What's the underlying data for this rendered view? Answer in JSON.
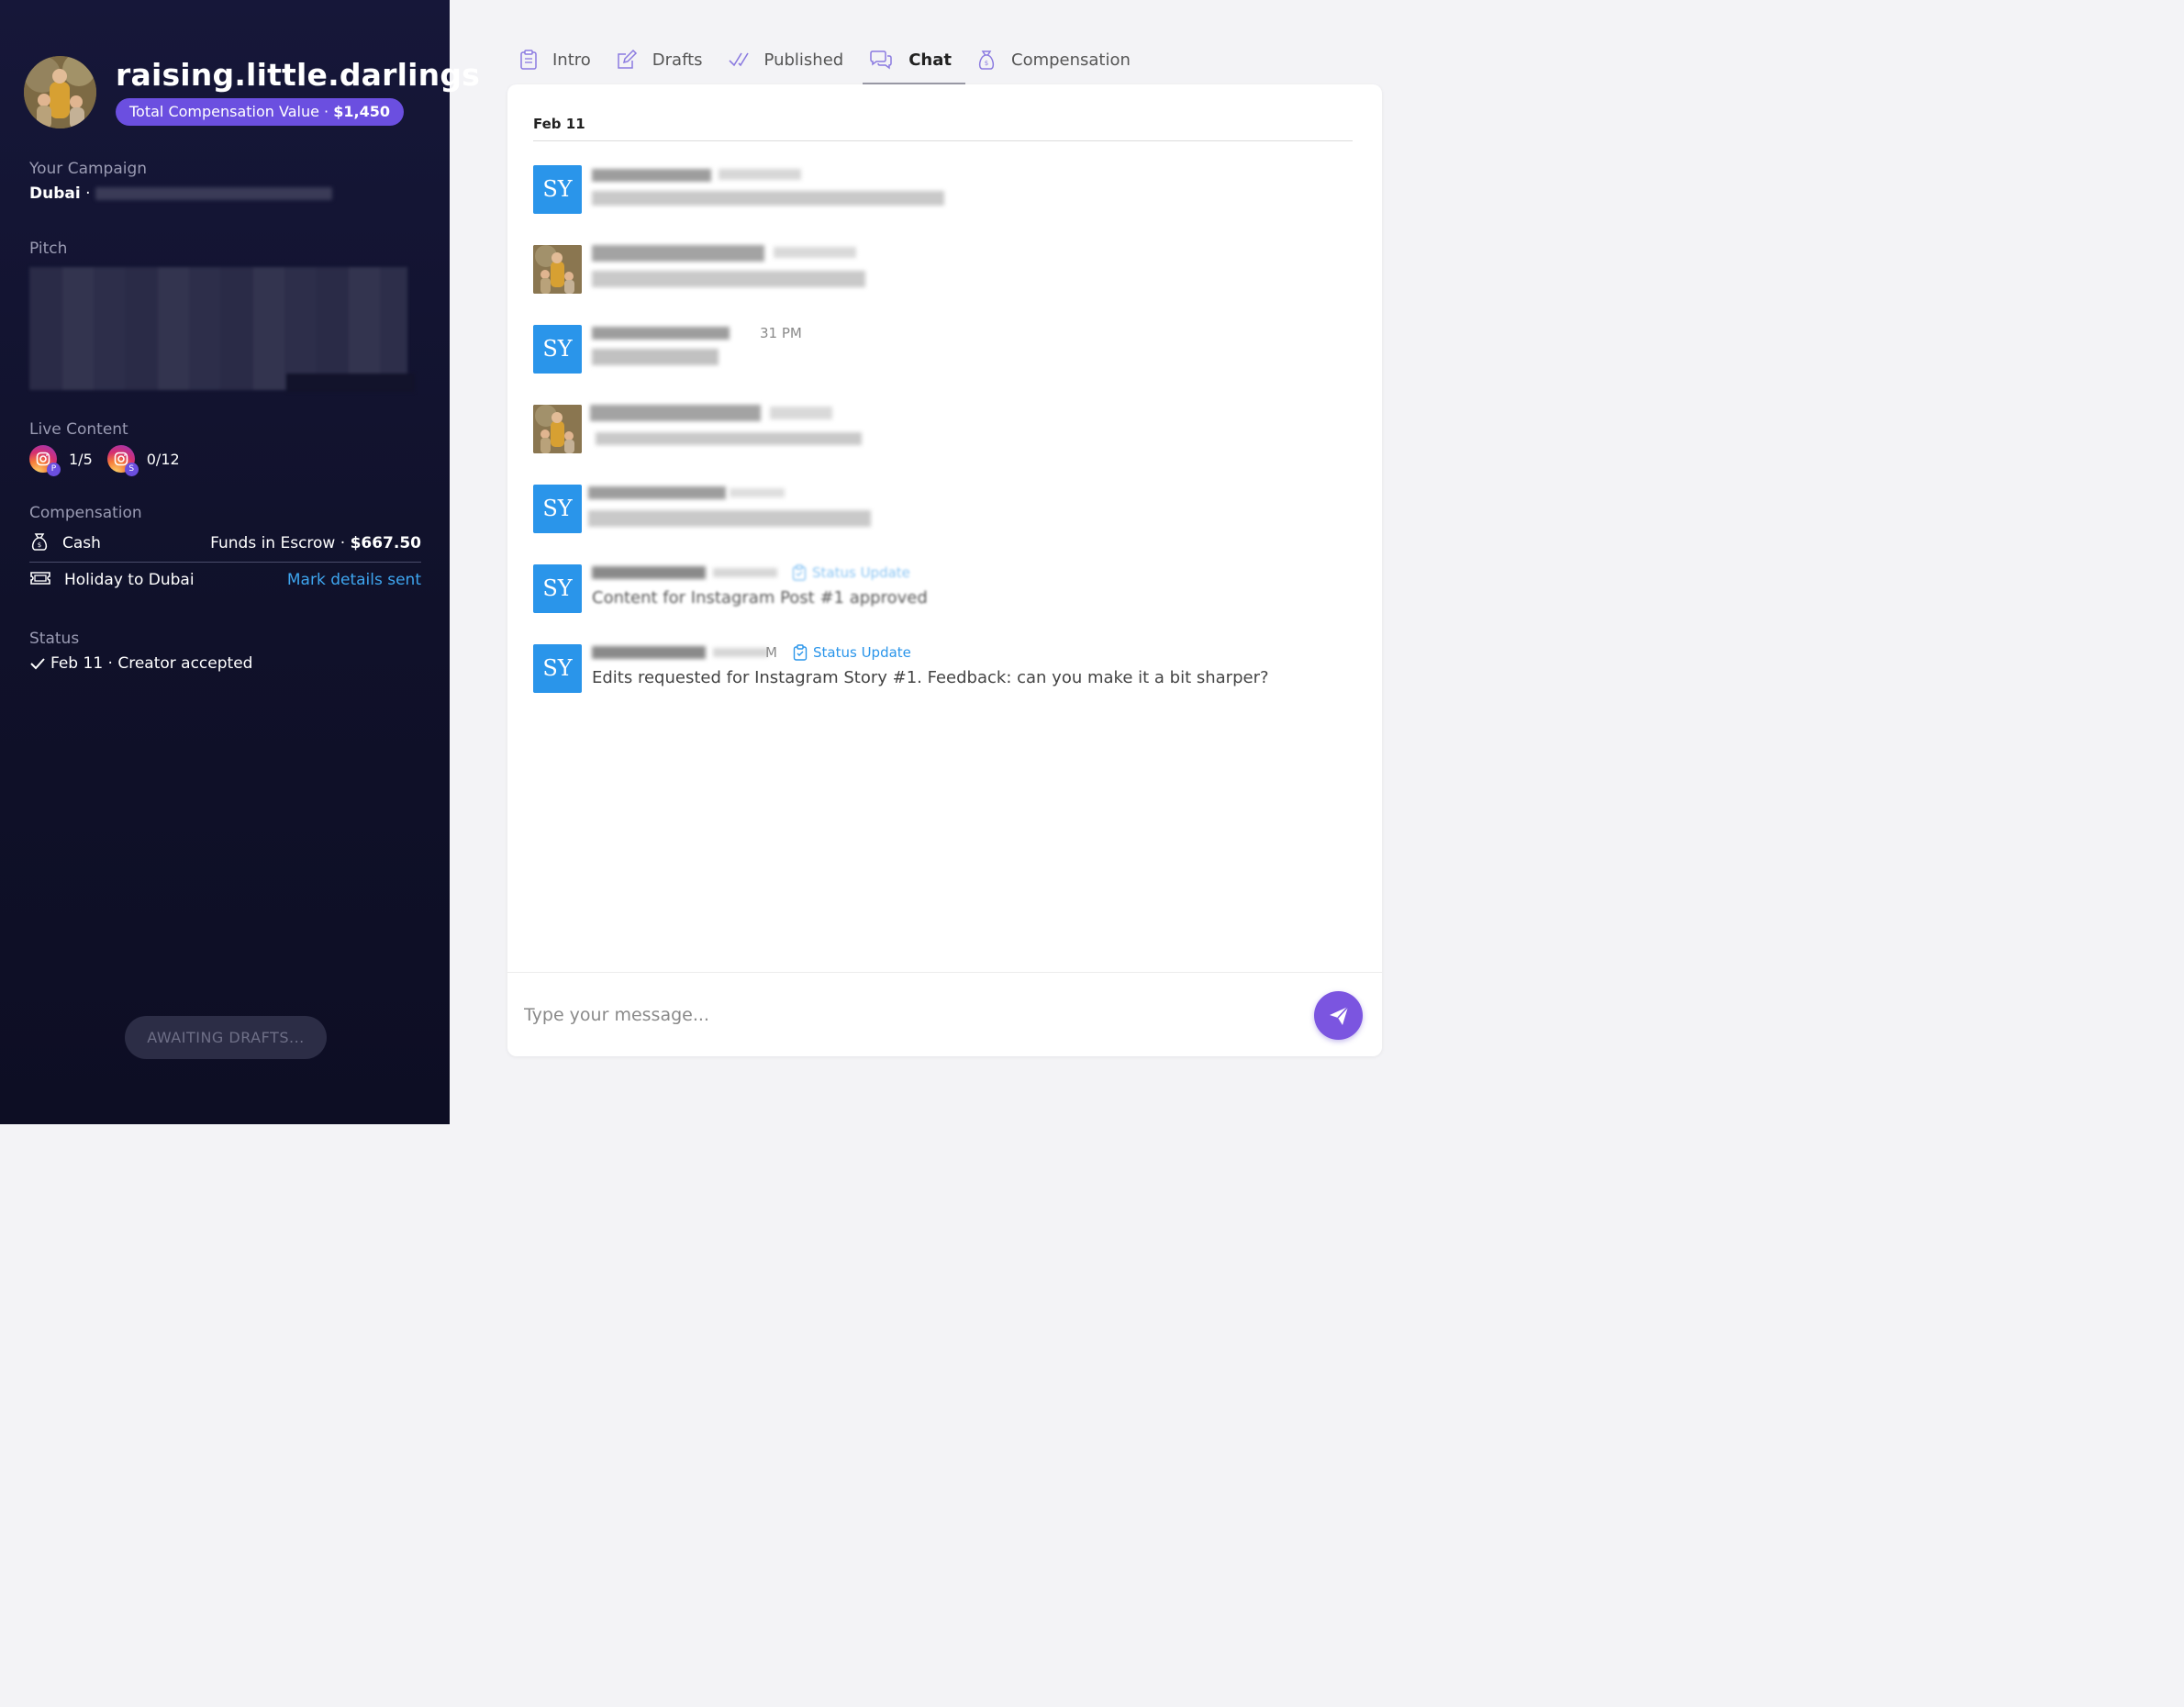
{
  "profile": {
    "handle": "raising.little.darlings",
    "tcv_label": "Total Compensation Value · ",
    "tcv_value": "$1,450"
  },
  "campaign": {
    "label": "Your Campaign",
    "name": "Dubai",
    "separator": " · "
  },
  "pitch": {
    "label": "Pitch"
  },
  "live_content": {
    "label": "Live Content",
    "items": [
      {
        "icon": "instagram-post-icon",
        "sub": "P",
        "count": "1/5"
      },
      {
        "icon": "instagram-story-icon",
        "sub": "S",
        "count": "0/12"
      }
    ]
  },
  "compensation": {
    "label": "Compensation",
    "cash": {
      "label": "Cash",
      "right_text": "Funds in Escrow · ",
      "right_value": "$667.50"
    },
    "holiday": {
      "label": "Holiday to Dubai",
      "action": "Mark details sent"
    }
  },
  "status": {
    "label": "Status",
    "text": "Feb 11 · Creator accepted"
  },
  "awaiting_button": "AWAITING DRAFTS...",
  "tabs": [
    {
      "label": "Intro",
      "icon": "clipboard-icon"
    },
    {
      "label": "Drafts",
      "icon": "edit-icon"
    },
    {
      "label": "Published",
      "icon": "double-check-icon"
    },
    {
      "label": "Chat",
      "icon": "chat-bubbles-icon",
      "active": true
    },
    {
      "label": "Compensation",
      "icon": "money-bag-icon"
    }
  ],
  "chat": {
    "date": "Feb 11",
    "avatar_initials": "SY",
    "messages": [
      {
        "sender": "SY",
        "time": "",
        "text": ""
      },
      {
        "sender": "creator",
        "time": "",
        "text": ""
      },
      {
        "sender": "SY",
        "time": "31 PM",
        "text": ""
      },
      {
        "sender": "creator",
        "time": "",
        "text": ""
      },
      {
        "sender": "SY",
        "time": "",
        "text": ""
      },
      {
        "sender": "SY",
        "time": "",
        "status_tag": "Status Update",
        "text": "Content for Instagram Post #1 approved"
      },
      {
        "sender": "SY",
        "time": "M",
        "status_tag": "Status Update",
        "text": "Edits requested for Instagram Story #1. Feedback: can you make it a bit sharper?"
      }
    ],
    "input_placeholder": "Type your message..."
  },
  "colors": {
    "sidebar_bg": "#13142f",
    "accent_purple": "#6b4fe0",
    "link_blue": "#3ea6f0",
    "avatar_blue": "#2a95ea",
    "send_button": "#7b55e0"
  }
}
